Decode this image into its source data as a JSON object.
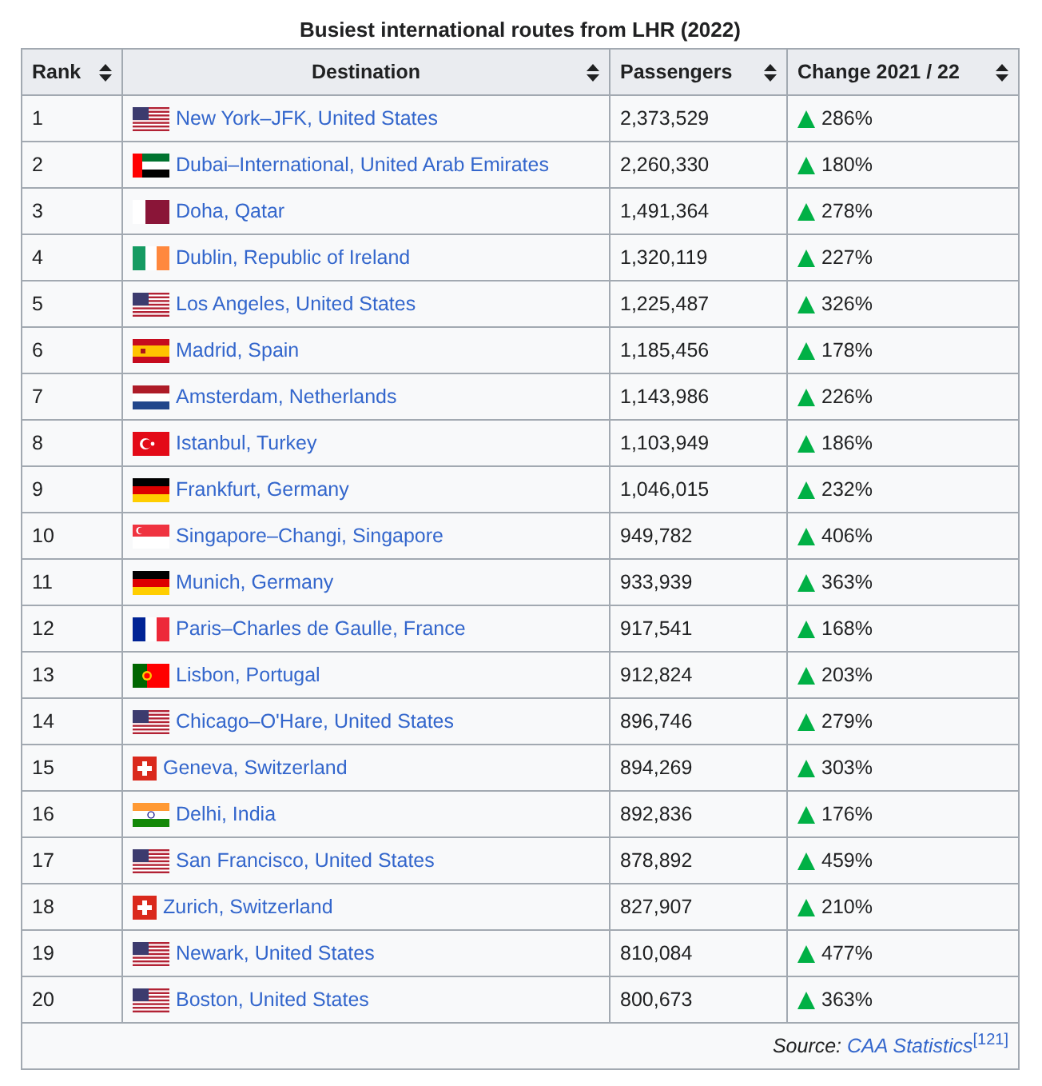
{
  "caption": "Busiest international routes from LHR (2022)",
  "columns": [
    {
      "label": "Rank"
    },
    {
      "label": "Destination"
    },
    {
      "label": "Passengers"
    },
    {
      "label": "Change 2021 / 22"
    }
  ],
  "rows": [
    {
      "rank": "1",
      "flag": {
        "kind": "us"
      },
      "destination": "New York–JFK, United States",
      "passengers": "2,373,529",
      "change": {
        "kind": "up",
        "text": "286%"
      }
    },
    {
      "rank": "2",
      "flag": {
        "kind": "ae"
      },
      "destination": "Dubai–International, United Arab Emirates",
      "passengers": "2,260,330",
      "change": {
        "kind": "up",
        "text": "180%"
      }
    },
    {
      "rank": "3",
      "flag": {
        "kind": "qa"
      },
      "destination": "Doha, Qatar",
      "passengers": "1,491,364",
      "change": {
        "kind": "up",
        "text": "278%"
      }
    },
    {
      "rank": "4",
      "flag": {
        "kind": "ie"
      },
      "destination": "Dublin, Republic of Ireland",
      "passengers": "1,320,119",
      "change": {
        "kind": "up",
        "text": "227%"
      }
    },
    {
      "rank": "5",
      "flag": {
        "kind": "us"
      },
      "destination": "Los Angeles, United States",
      "passengers": "1,225,487",
      "change": {
        "kind": "up",
        "text": "326%"
      }
    },
    {
      "rank": "6",
      "flag": {
        "kind": "es"
      },
      "destination": "Madrid, Spain",
      "passengers": "1,185,456",
      "change": {
        "kind": "up",
        "text": "178%"
      }
    },
    {
      "rank": "7",
      "flag": {
        "kind": "nl"
      },
      "destination": "Amsterdam, Netherlands",
      "passengers": "1,143,986",
      "change": {
        "kind": "up",
        "text": "226%"
      }
    },
    {
      "rank": "8",
      "flag": {
        "kind": "tr"
      },
      "destination": "Istanbul, Turkey",
      "passengers": "1,103,949",
      "change": {
        "kind": "up",
        "text": "186%"
      }
    },
    {
      "rank": "9",
      "flag": {
        "kind": "de"
      },
      "destination": "Frankfurt, Germany",
      "passengers": "1,046,015",
      "change": {
        "kind": "up",
        "text": "232%"
      }
    },
    {
      "rank": "10",
      "flag": {
        "kind": "sg"
      },
      "destination": "Singapore–Changi, Singapore",
      "passengers": "949,782",
      "change": {
        "kind": "up",
        "text": "406%"
      }
    },
    {
      "rank": "11",
      "flag": {
        "kind": "de"
      },
      "destination": "Munich, Germany",
      "passengers": "933,939",
      "change": {
        "kind": "up",
        "text": "363%"
      }
    },
    {
      "rank": "12",
      "flag": {
        "kind": "fr"
      },
      "destination": "Paris–Charles de Gaulle, France",
      "passengers": "917,541",
      "change": {
        "kind": "up",
        "text": "168%"
      }
    },
    {
      "rank": "13",
      "flag": {
        "kind": "pt"
      },
      "destination": "Lisbon, Portugal",
      "passengers": "912,824",
      "change": {
        "kind": "up",
        "text": "203%"
      }
    },
    {
      "rank": "14",
      "flag": {
        "kind": "us"
      },
      "destination": "Chicago–O'Hare, United States",
      "passengers": "896,746",
      "change": {
        "kind": "up",
        "text": "279%"
      }
    },
    {
      "rank": "15",
      "flag": {
        "kind": "ch"
      },
      "destination": "Geneva, Switzerland",
      "passengers": "894,269",
      "change": {
        "kind": "up",
        "text": "303%"
      }
    },
    {
      "rank": "16",
      "flag": {
        "kind": "in"
      },
      "destination": "Delhi, India",
      "passengers": "892,836",
      "change": {
        "kind": "up",
        "text": "176%"
      }
    },
    {
      "rank": "17",
      "flag": {
        "kind": "us"
      },
      "destination": "San Francisco, United States",
      "passengers": "878,892",
      "change": {
        "kind": "up",
        "text": "459%"
      }
    },
    {
      "rank": "18",
      "flag": {
        "kind": "ch"
      },
      "destination": "Zurich, Switzerland",
      "passengers": "827,907",
      "change": {
        "kind": "up",
        "text": "210%"
      }
    },
    {
      "rank": "19",
      "flag": {
        "kind": "us"
      },
      "destination": "Newark, United States",
      "passengers": "810,084",
      "change": {
        "kind": "up",
        "text": "477%"
      }
    },
    {
      "rank": "20",
      "flag": {
        "kind": "us"
      },
      "destination": "Boston, United States",
      "passengers": "800,673",
      "change": {
        "kind": "up",
        "text": "363%"
      }
    }
  ],
  "source": {
    "label": "Source:",
    "link": "CAA Statistics",
    "ref": "[121]"
  }
}
